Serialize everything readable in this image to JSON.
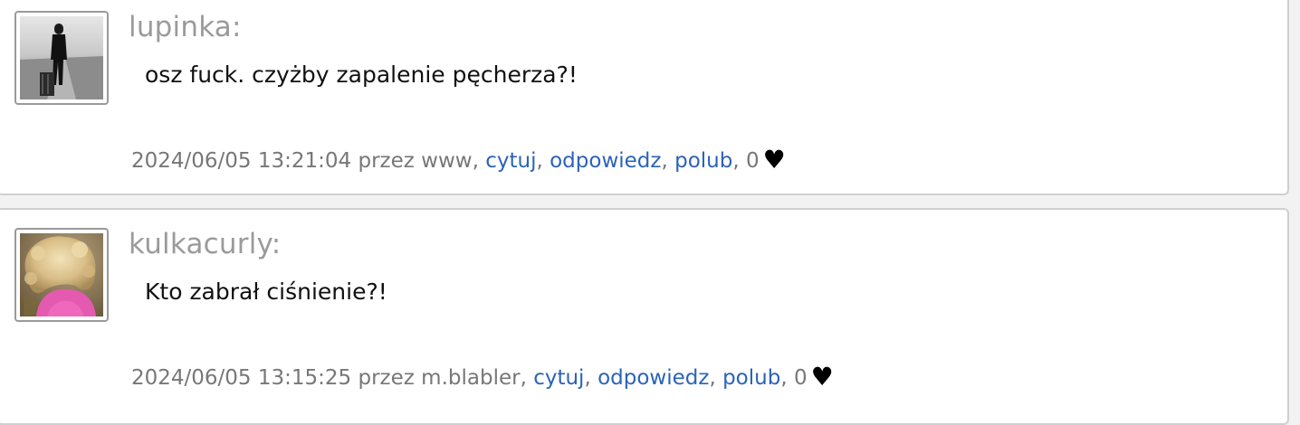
{
  "colors": {
    "author": "#9b9b9b",
    "link": "#2b63b9",
    "meta": "#777777",
    "message": "#111111",
    "heart": "#000000"
  },
  "posts": [
    {
      "author": "lupinka:",
      "message": "osz fuck. czyżby zapalenie pęcherza?!",
      "timestamp": "2024/06/05 13:21:04",
      "by_prefix": "przez",
      "by_user": "www",
      "quote_label": "cytuj",
      "reply_label": "odpowiedz",
      "like_label": "polub",
      "likes": "0",
      "heart_icon": "heart-icon"
    },
    {
      "author": "kulkacurly:",
      "message": "Kto zabrał ciśnienie?!",
      "timestamp": "2024/06/05 13:15:25",
      "by_prefix": "przez",
      "by_user": "m.blabler",
      "quote_label": "cytuj",
      "reply_label": "odpowiedz",
      "like_label": "polub",
      "likes": "0",
      "heart_icon": "heart-icon"
    }
  ]
}
